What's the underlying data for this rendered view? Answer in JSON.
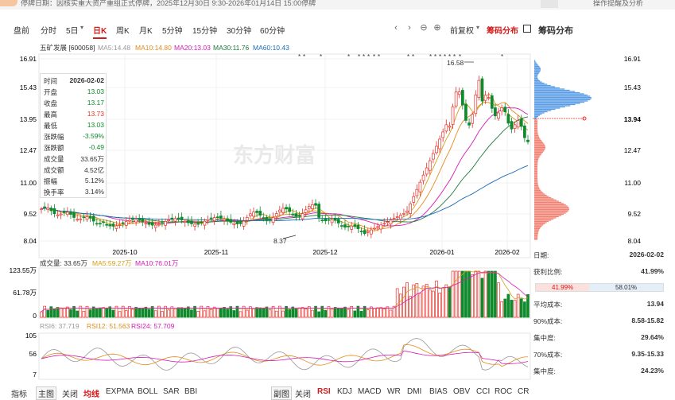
{
  "notice": {
    "text": "停牌日期：因核实重大资产重组正式停牌，2025年12月30日 9:30-2026年01月14日 15:00停牌",
    "right_text": "操作提醒及分析"
  },
  "toolbar": {
    "items": [
      "盘前",
      "分时",
      "5日",
      "日K",
      "周K",
      "月K",
      "5分钟",
      "15分钟",
      "30分钟",
      "60分钟"
    ],
    "active": "日K",
    "adjust_label": "前复权",
    "chip_label": "筹码分布",
    "chip_panel_label": "筹码分布"
  },
  "chart_header": {
    "stock": "五矿发展 [600058]",
    "ma5": "MA5:14.48",
    "ma10": "MA10:14.80",
    "ma20": "MA20:13.03",
    "ma30": "MA30:11.76",
    "ma60": "MA60:10.43"
  },
  "colors": {
    "up": "#e8312a",
    "down": "#0f8a2c",
    "ma5": "#d4a017",
    "ma10": "#e48a1a",
    "ma20": "#d61ab7",
    "ma30": "#1c7a3c",
    "ma60": "#1a6bb8"
  },
  "price_axis": [
    "16.91",
    "15.43",
    "13.95",
    "12.47",
    "11.00",
    "9.52",
    "8.04"
  ],
  "chip_axis": [
    "16.91",
    "15.43",
    "13.94",
    "12.47",
    "11.00",
    "9.52",
    "8.04"
  ],
  "date_axis": [
    "2025-10",
    "2025-11",
    "2025-12",
    "2026-01",
    "2026-02"
  ],
  "annotations": {
    "high": "16.58",
    "low": "8.37"
  },
  "watermark": "东方财富",
  "tooltip": {
    "rows": [
      {
        "k": "时间",
        "v": "2026-02-02",
        "c": "#333"
      },
      {
        "k": "开盘",
        "v": "13.03",
        "c": "#0f8a2c"
      },
      {
        "k": "收盘",
        "v": "13.17",
        "c": "#0f8a2c"
      },
      {
        "k": "最高",
        "v": "13.73",
        "c": "#e8312a"
      },
      {
        "k": "最低",
        "v": "13.03",
        "c": "#0f8a2c"
      },
      {
        "k": "涨跌幅",
        "v": "-3.59%",
        "c": "#0f8a2c"
      },
      {
        "k": "涨跌额",
        "v": "-0.49",
        "c": "#0f8a2c"
      },
      {
        "k": "成交量",
        "v": "33.65万",
        "c": "#333"
      },
      {
        "k": "成交额",
        "v": "4.52亿",
        "c": "#333"
      },
      {
        "k": "振幅",
        "v": "5.12%",
        "c": "#333"
      },
      {
        "k": "换手率",
        "v": "3.14%",
        "c": "#333"
      }
    ]
  },
  "volume_header": {
    "vol": "成交量: 33.65万",
    "ma5": "MA5:59.27万",
    "ma10": "MA10:76.01万"
  },
  "volume_axis": [
    "123.55万",
    "61.78万",
    "0"
  ],
  "rsi_header": {
    "rsi6": "RSI6: 37.719",
    "rsi12": "RSI12: 51.563",
    "rsi24": "RSI24: 57.709"
  },
  "rsi_axis": [
    "105",
    "56",
    "7"
  ],
  "chip_current": "13.94",
  "chip_stats": {
    "date_k": "日期:",
    "date_v": "2026-02-02",
    "profit_k": "获利比例:",
    "profit_v": "41.99%",
    "win_pct": "41.99%",
    "loss_pct": "58.01%",
    "avg_k": "平均成本:",
    "avg_v": "13.94",
    "c90_k": "90%成本:",
    "c90_v": "8.58-15.82",
    "con90_k": "集中度:",
    "con90_v": "29.64%",
    "c70_k": "70%成本:",
    "c70_v": "9.35-15.33",
    "con70_k": "集中度:",
    "con70_v": "24.23%"
  },
  "bottom": {
    "left": [
      "指标",
      "主图",
      "关闭",
      "均线",
      "EXPMA",
      "BOLL",
      "SAR",
      "BBI"
    ],
    "left_active": "均线",
    "right": [
      "副图",
      "关闭",
      "RSI",
      "KDJ",
      "MACD",
      "WR",
      "DMI",
      "BIAS",
      "OBV",
      "CCI",
      "ROC",
      "CR"
    ],
    "right_active": "RSI"
  }
}
